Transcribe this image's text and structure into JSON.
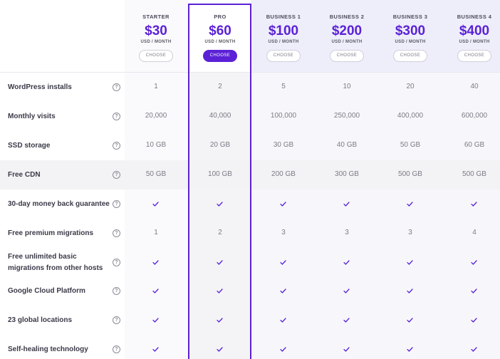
{
  "plans": [
    {
      "name": "STARTER",
      "price": "$30",
      "unit": "USD / MONTH",
      "button": "CHOOSE"
    },
    {
      "name": "PRO",
      "price": "$60",
      "unit": "USD / MONTH",
      "button": "CHOOSE"
    },
    {
      "name": "BUSINESS 1",
      "price": "$100",
      "unit": "USD / MONTH",
      "button": "CHOOSE"
    },
    {
      "name": "BUSINESS 2",
      "price": "$200",
      "unit": "USD / MONTH",
      "button": "CHOOSE"
    },
    {
      "name": "BUSINESS 3",
      "price": "$300",
      "unit": "USD / MONTH",
      "button": "CHOOSE"
    },
    {
      "name": "BUSINESS 4",
      "price": "$400",
      "unit": "USD / MONTH",
      "button": "CHOOSE"
    }
  ],
  "rows": [
    {
      "label": "WordPress installs",
      "values": [
        "1",
        "2",
        "5",
        "10",
        "20",
        "40"
      ]
    },
    {
      "label": "Monthly visits",
      "values": [
        "20,000",
        "40,000",
        "100,000",
        "250,000",
        "400,000",
        "600,000"
      ]
    },
    {
      "label": "SSD storage",
      "values": [
        "10 GB",
        "20 GB",
        "30 GB",
        "40 GB",
        "50 GB",
        "60 GB"
      ]
    },
    {
      "label": "Free CDN",
      "values": [
        "50 GB",
        "100 GB",
        "200 GB",
        "300 GB",
        "500 GB",
        "500 GB"
      ]
    },
    {
      "label": "30-day money back guarantee",
      "values": [
        "check",
        "check",
        "check",
        "check",
        "check",
        "check"
      ]
    },
    {
      "label": "Free premium migrations",
      "values": [
        "1",
        "2",
        "3",
        "3",
        "3",
        "4"
      ]
    },
    {
      "label": "Free unlimited basic migrations from other hosts",
      "values": [
        "check",
        "check",
        "check",
        "check",
        "check",
        "check"
      ]
    },
    {
      "label": "Google Cloud Platform",
      "values": [
        "check",
        "check",
        "check",
        "check",
        "check",
        "check"
      ]
    },
    {
      "label": "23 global locations",
      "values": [
        "check",
        "check",
        "check",
        "check",
        "check",
        "check"
      ]
    },
    {
      "label": "Self-healing technology",
      "values": [
        "check",
        "check",
        "check",
        "check",
        "check",
        "check"
      ]
    }
  ],
  "icons": {
    "help": "question-circle-icon",
    "check": "checkmark-icon"
  },
  "help_glyph": "?",
  "colors": {
    "accent": "#5b21d6",
    "check": "#5b21d6",
    "shaded_row": "#f3f3f5",
    "business_header": "#eeeefb"
  }
}
